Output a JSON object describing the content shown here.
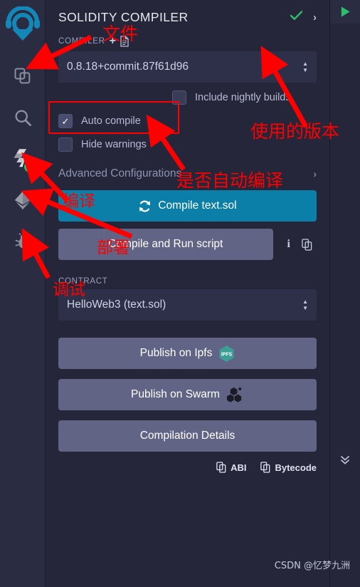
{
  "window": {
    "title": "SOLIDITY COMPILER"
  },
  "rail": {
    "logo_icon": "remix-logo-icon",
    "items": [
      {
        "name": "file-explorer",
        "icon": "files-copy-icon",
        "label": "File explorers"
      },
      {
        "name": "search",
        "icon": "magnifier-icon",
        "label": "Search in files"
      },
      {
        "name": "solidity-compiler",
        "icon": "solidity-logo-icon",
        "label": "Solidity compiler",
        "badge": "check",
        "active": true
      },
      {
        "name": "deploy-run",
        "icon": "ethereum-diamond-icon",
        "label": "Deploy & run transactions"
      },
      {
        "name": "debugger",
        "icon": "bug-icon",
        "label": "Debugger"
      }
    ]
  },
  "header": {
    "title": "SOLIDITY COMPILER",
    "check_icon": "check-icon",
    "expand_icon": "chevron-right-icon"
  },
  "compiler": {
    "section_label": "COMPILER",
    "add_icon": "plus-icon",
    "doc_icon": "document-icon",
    "version": "0.8.18+commit.87f61d96",
    "spinner_up": "▲",
    "spinner_down": "▼"
  },
  "options": {
    "include_nightly": {
      "label": "Include nightly builds",
      "checked": false
    },
    "auto_compile": {
      "label": "Auto compile",
      "checked": true
    },
    "hide_warnings": {
      "label": "Hide warnings",
      "checked": false
    }
  },
  "advanced": {
    "label": "Advanced Configurations",
    "chevron": "chevron-right-icon"
  },
  "actions": {
    "compile": {
      "label": "Compile text.sol",
      "icon": "refresh-icon",
      "color": "#0b7fa8"
    },
    "compile_run": {
      "label": "Compile and Run script",
      "color": "#616485"
    },
    "info_icon": "info-icon",
    "copy_icon": "copy-icon"
  },
  "contract": {
    "section_label": "CONTRACT",
    "selected": "HelloWeb3 (text.sol)"
  },
  "publish": {
    "ipfs": {
      "label": "Publish on Ipfs",
      "icon": "ipfs-logo-icon",
      "color": "#3d9e96"
    },
    "swarm": {
      "label": "Publish on Swarm",
      "icon": "swarm-logo-icon"
    },
    "details": {
      "label": "Compilation Details"
    }
  },
  "footer_links": [
    {
      "label": "ABI",
      "icon": "copy-icon"
    },
    {
      "label": "Bytecode",
      "icon": "copy-icon"
    }
  ],
  "right_strip": {
    "run_icon": "play-triangle-icon",
    "collapse_icon": "double-chevron-down-icon"
  },
  "annotations": {
    "accent_color": "#fe0000",
    "file": "文件",
    "version_used": "使用的版本",
    "auto_compile_q": "是否自动编译",
    "compile": "编译",
    "deploy": "部署",
    "debug": "调试"
  },
  "watermark": "CSDN @忆梦九洲"
}
